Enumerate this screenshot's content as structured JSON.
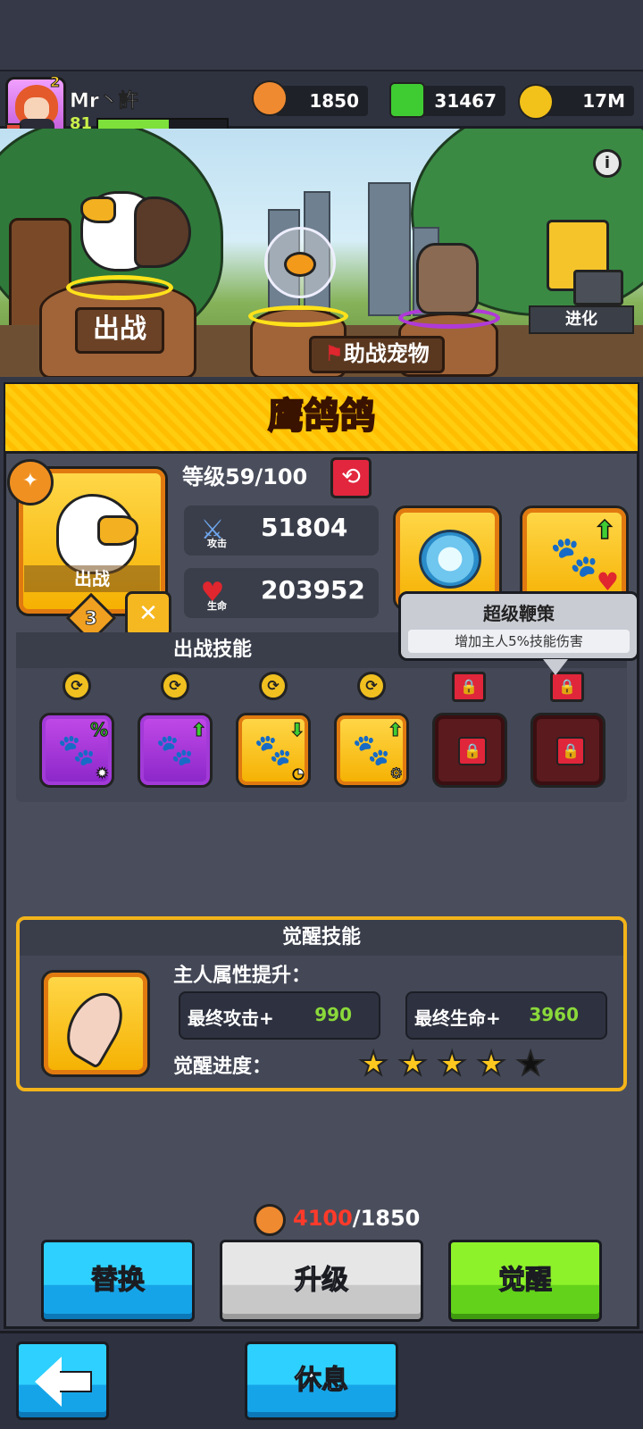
{
  "player": {
    "name": "Mr丶許",
    "level": "81",
    "rank": "2",
    "xp_fraction": 0.55
  },
  "currencies": [
    {
      "name": "orange-token",
      "value": "1850",
      "color": "#f08a30"
    },
    {
      "name": "green-gem",
      "value": "31467",
      "color": "#3fcc33"
    },
    {
      "name": "gold-coin",
      "value": "17M",
      "color": "#f3c21a"
    }
  ],
  "scene": {
    "deploy_label": "出战",
    "assist_label": "助战宠物",
    "evolve_label": "进化",
    "info_icon": "i"
  },
  "pet": {
    "name": "鹰鸽鸽",
    "level_text": "等级59/100",
    "portrait_label": "出战",
    "stars": "3",
    "attack": "51804",
    "attack_label": "攻击",
    "hp": "203952",
    "hp_label": "生命"
  },
  "tooltip": {
    "title": "超级鞭策",
    "desc": "增加主人5%技能伤害"
  },
  "battle_skills": {
    "title": "出战技能"
  },
  "awaken": {
    "title": "觉醒技能",
    "boost_label": "主人属性提升：",
    "atk_key": "最终攻击+",
    "atk_val": "990",
    "hp_key": "最终生命+",
    "hp_val": "3960",
    "progress_label": "觉醒进度：",
    "stars_filled": 4,
    "stars_total": 5
  },
  "cost": {
    "need": "4100",
    "have": "/1850"
  },
  "buttons": {
    "replace": "替换",
    "upgrade": "升级",
    "awaken": "觉醒",
    "rest": "休息"
  },
  "colors": {
    "accent_yellow": "#ffcc10",
    "title_red": "#ff3d2e",
    "value_green": "#8ad93a"
  }
}
